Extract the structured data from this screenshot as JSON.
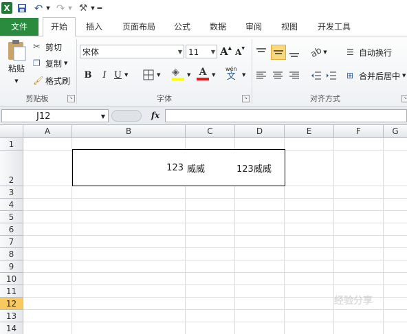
{
  "qat": {
    "excel_icon_label": "X",
    "more_label": "="
  },
  "tabs": [
    {
      "label": "文件"
    },
    {
      "label": "开始"
    },
    {
      "label": "插入"
    },
    {
      "label": "页面布局"
    },
    {
      "label": "公式"
    },
    {
      "label": "数据"
    },
    {
      "label": "审阅"
    },
    {
      "label": "视图"
    },
    {
      "label": "开发工具"
    }
  ],
  "clipboard": {
    "paste_label": "粘贴",
    "cut_label": "剪切",
    "copy_label": "复制",
    "format_painter_label": "格式刷",
    "group_label": "剪贴板"
  },
  "font": {
    "font_name": "宋体",
    "font_size": "11",
    "grow_label": "A",
    "shrink_label": "A",
    "bold_label": "B",
    "italic_label": "I",
    "underline_label": "U",
    "fill_label": "◈",
    "font_color_label": "A",
    "phonetic_label": "wén",
    "phonetic_char": "文",
    "group_label": "字体"
  },
  "alignment": {
    "wrap_label": "自动换行",
    "merge_label": "合并后居中",
    "group_label": "对齐方式"
  },
  "formula_bar": {
    "name_box": "J12",
    "fx_label": "fx",
    "formula": ""
  },
  "columns": [
    "A",
    "B",
    "C",
    "D",
    "E",
    "F",
    "G"
  ],
  "rows": [
    "1",
    "2",
    "3",
    "4",
    "5",
    "6",
    "7",
    "8",
    "9",
    "10",
    "11",
    "12",
    "13",
    "14"
  ],
  "cells": {
    "B2": "123",
    "C2": "威威",
    "D2": "123威威"
  },
  "watermark": "经验分享"
}
